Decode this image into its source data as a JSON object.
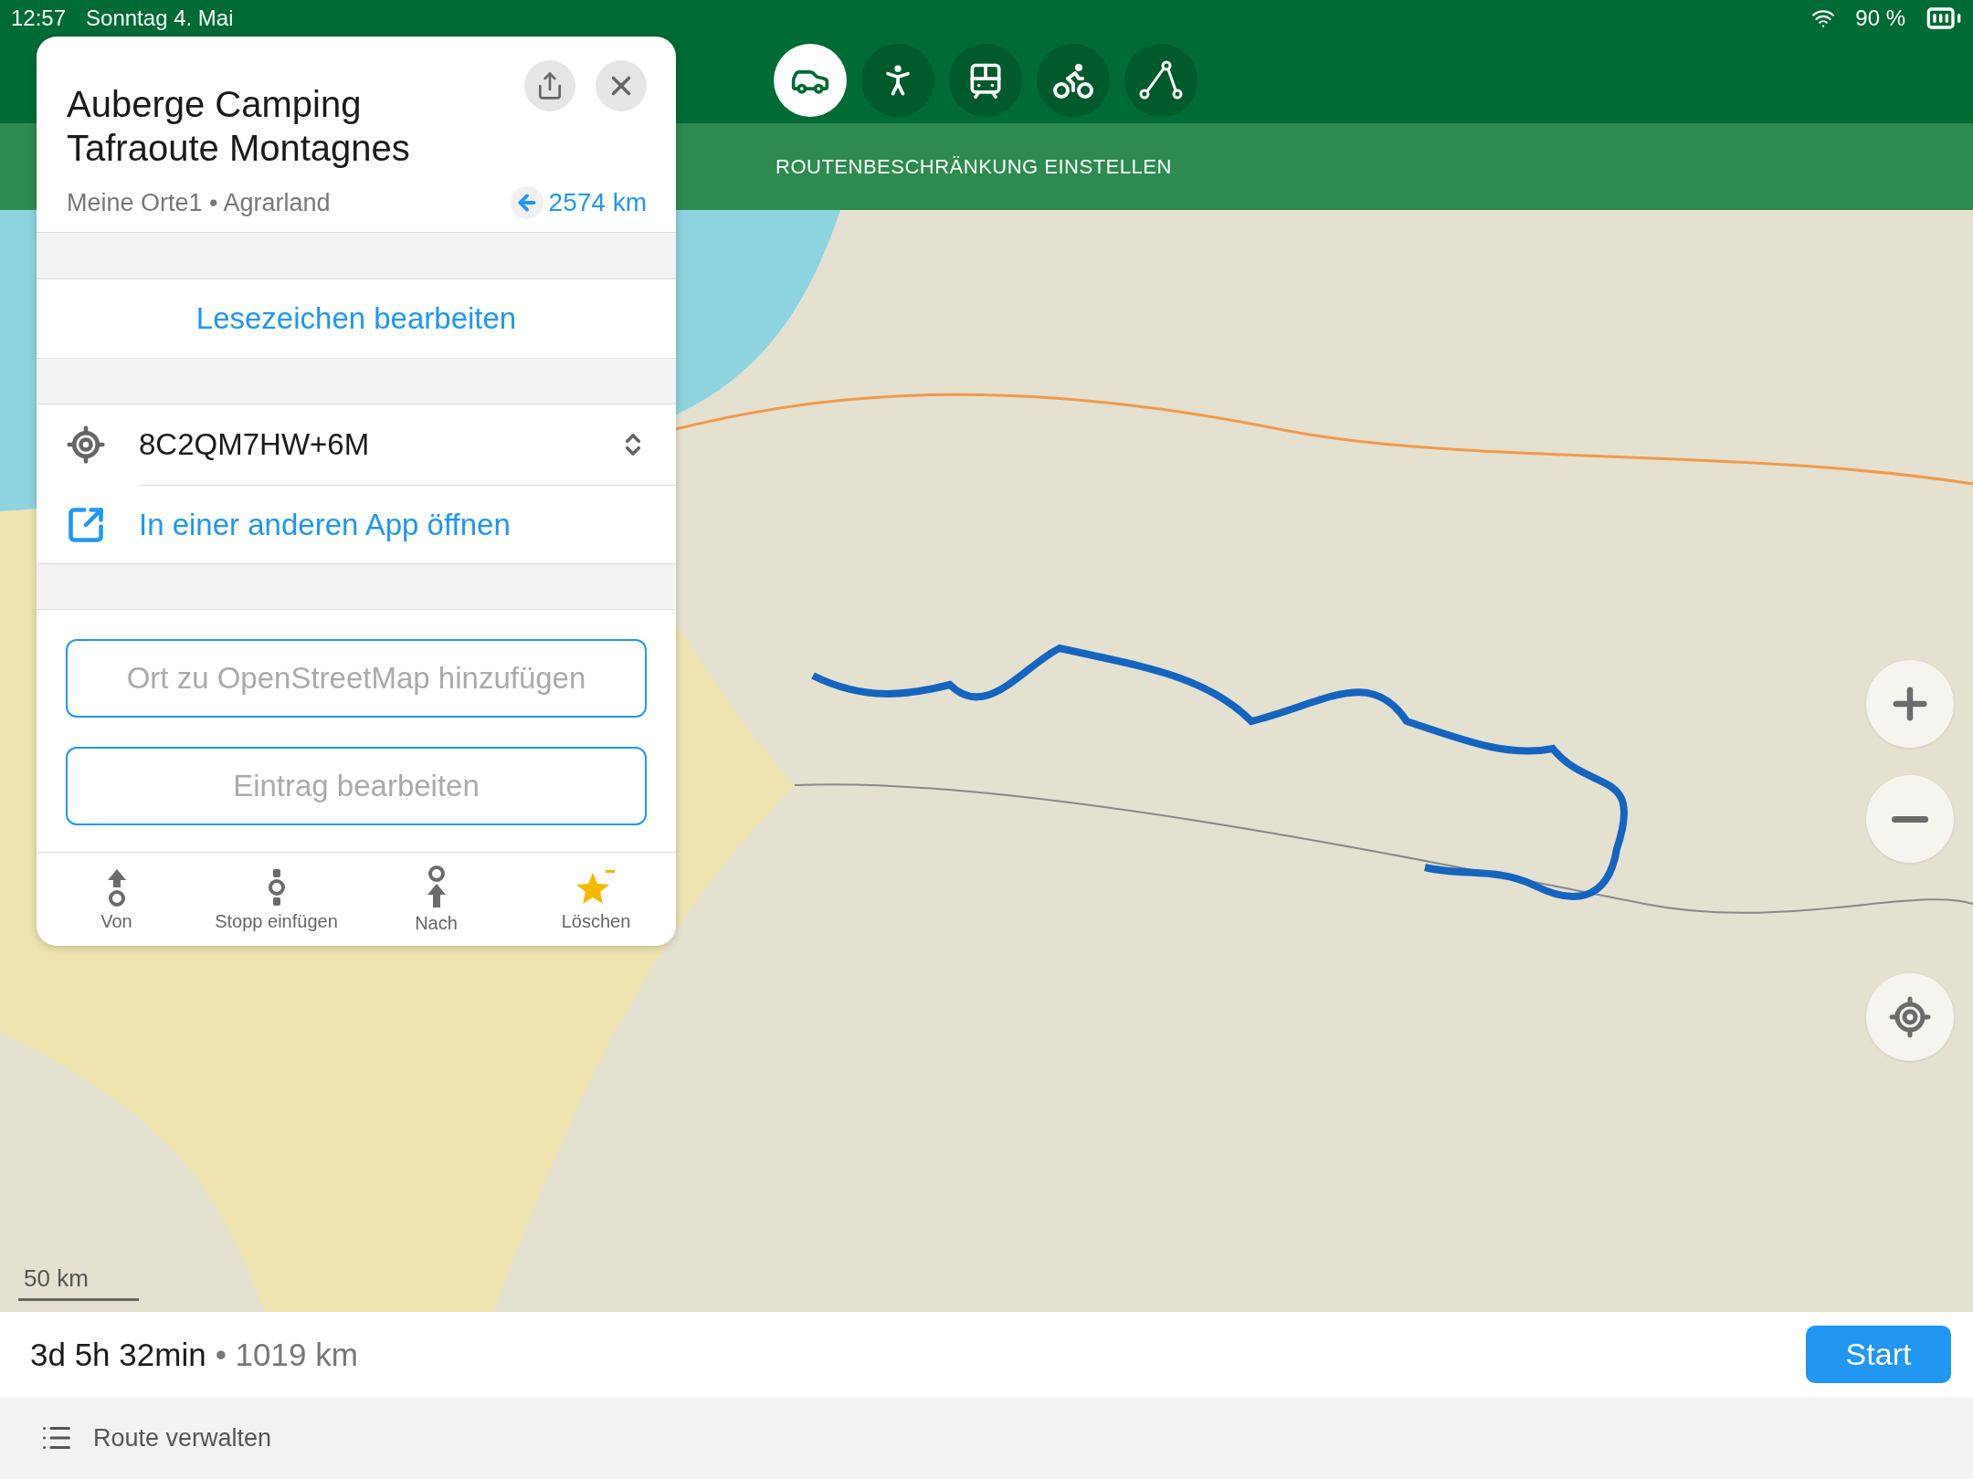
{
  "status_bar": {
    "time": "12:57",
    "date": "Sonntag 4. Mai",
    "battery": "90 %"
  },
  "transport_modes": [
    {
      "kind": "car",
      "selected": true
    },
    {
      "kind": "walk",
      "selected": false
    },
    {
      "kind": "transit",
      "selected": false
    },
    {
      "kind": "bike",
      "selected": false
    },
    {
      "kind": "straight",
      "selected": false
    }
  ],
  "restriction_button": "ROUTENBESCHRÄNKUNG EINSTELLEN",
  "place": {
    "title": "Auberge Camping Tafraoute Montagnes",
    "subtitle": "Meine Orte1 • Agrarland",
    "distance": "2574 km",
    "edit_bookmark": "Lesezeichen bearbeiten",
    "plus_code": "8C2QM7HW+6M",
    "open_in_app": "In einer anderen App öffnen",
    "buttons": [
      "Ort zu OpenStreetMap hinzufügen",
      "Eintrag bearbeiten"
    ],
    "actions": [
      {
        "kind": "from",
        "label": "Von"
      },
      {
        "kind": "stop",
        "label": "Stopp einfügen"
      },
      {
        "kind": "to",
        "label": "Nach"
      },
      {
        "kind": "delete",
        "label": "Löschen"
      }
    ]
  },
  "map": {
    "scale": "50 km"
  },
  "route_summary": {
    "duration": "3d 5h 32min",
    "distance": "• 1019 km",
    "start": "Start"
  },
  "manage_route": "Route verwalten"
}
